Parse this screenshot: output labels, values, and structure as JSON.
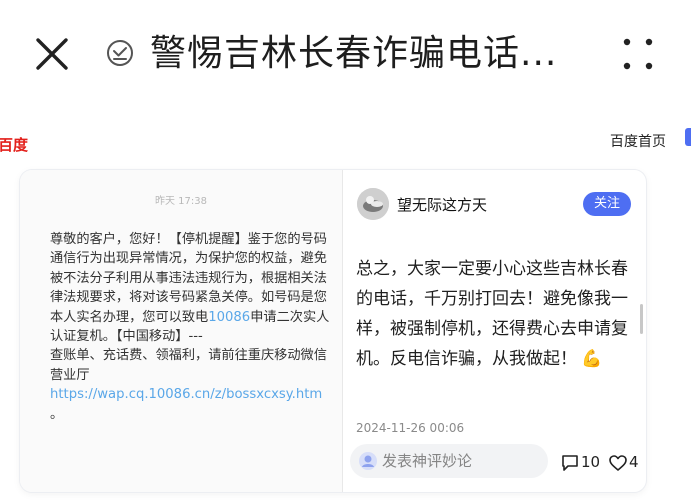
{
  "header": {
    "title": "警惕吉林长春诈骗电话..."
  },
  "site": {
    "logo_text": "百度",
    "home_link": "百度首页"
  },
  "sms": {
    "time": "昨天 17:38",
    "body_before_number": "尊敬的客户，您好！【停机提醒】鉴于您的号码通信行为出现异常情况，为保护您的权益，避免被不法分子利用从事违法违规行为，根据相关法律法规要求，将对该号码紧急关停。如号码是您本人实名办理，您可以致电",
    "phone": "10086",
    "body_after_number": "申请二次实人认证复机。【中国移动】---",
    "body_second": "查账单、充话费、领福利，请前往重庆移动微信营业厅",
    "link": "https://wap.cq.10086.cn/z/bossxcxsy.htm",
    "body_end": " 。"
  },
  "post": {
    "author": "望无际这方天",
    "follow_label": "关注",
    "text": "总之，大家一定要小心这些吉林长春的电话，千万别打回去！避免像我一样，被强制停机，还得费心去申请复机。反电信诈骗，从我做起！",
    "emoji": "💪",
    "date": "2024-11-26 00:06",
    "comment_placeholder": "发表神评妙论",
    "comment_count": "10",
    "like_count": "4"
  },
  "colors": {
    "accent": "#4e6ef2",
    "baidu_red": "#e3201b",
    "link": "#5aa7e8"
  },
  "icons": [
    "close-icon",
    "verified-check-icon",
    "more-dots-icon",
    "user-icon",
    "comment-icon",
    "heart-icon",
    "flex-emoji"
  ]
}
